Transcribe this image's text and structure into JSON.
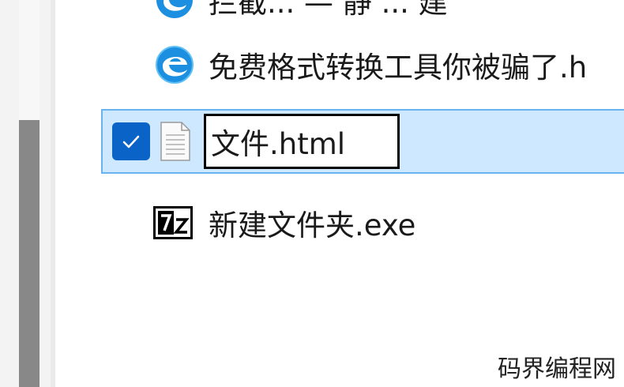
{
  "files": [
    {
      "name": "拦截... — 静 ... 建",
      "icon": "edge-icon",
      "selected": false,
      "clipped": true
    },
    {
      "name": "免费格式转换工具你被骗了.h",
      "icon": "edge-icon",
      "selected": false
    },
    {
      "name": "文件.html",
      "icon": "document-icon",
      "selected": true,
      "renaming": true,
      "checkbox_checked": true
    },
    {
      "name": "新建文件夹.exe",
      "icon": "7z-icon",
      "selected": false
    }
  ],
  "watermark": "码界编程网",
  "colors": {
    "selection_background": "#cde8ff",
    "selection_border": "#69b4f0",
    "checkbox": "#0a64c8",
    "edge_blue": "#1c8fe0",
    "scrollbar_thumb": "#888888"
  }
}
